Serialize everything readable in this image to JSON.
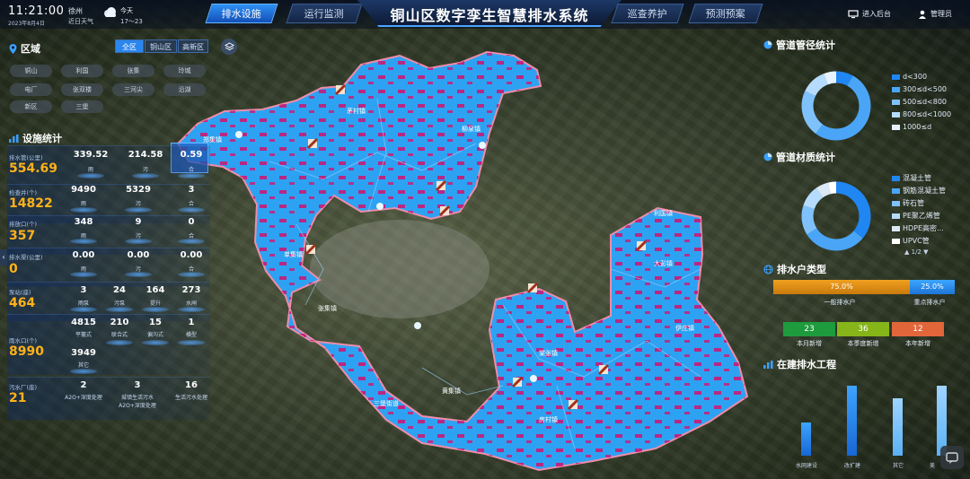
{
  "header": {
    "time": "11:21:00",
    "date": "2023年8月4日",
    "city": "徐州",
    "weather_label": "近日天气",
    "today_label": "今天",
    "temperature": "17～23",
    "title": "铜山区数字孪生智慧排水系统",
    "tabs": [
      "排水设施",
      "运行监测",
      "巡查养护",
      "预测预案"
    ],
    "active_tab": "排水设施",
    "backend": "进入后台",
    "user": "管理员"
  },
  "region": {
    "title": "区域",
    "segments": [
      "全区",
      "铜山区",
      "高新区"
    ],
    "active_segment": "全区",
    "districts": [
      "铜山",
      "利国",
      "张集",
      "玲城",
      "电厂",
      "张双楼",
      "三河尖",
      "沿湖",
      "新区",
      "三堡"
    ]
  },
  "facility": {
    "title": "设施统计",
    "rows": [
      {
        "label": "排水管(公里)",
        "total": "554.69",
        "cells": [
          {
            "value": "339.52",
            "sub": "雨"
          },
          {
            "value": "214.58",
            "sub": "污"
          },
          {
            "value": "0.59",
            "sub": "合"
          }
        ]
      },
      {
        "label": "检查井(个)",
        "total": "14822",
        "cells": [
          {
            "value": "9490",
            "sub": "雨"
          },
          {
            "value": "5329",
            "sub": "污"
          },
          {
            "value": "3",
            "sub": "合"
          }
        ]
      },
      {
        "label": "排放口(个)",
        "total": "357",
        "cells": [
          {
            "value": "348",
            "sub": "雨"
          },
          {
            "value": "9",
            "sub": "污"
          },
          {
            "value": "0",
            "sub": "合"
          }
        ]
      },
      {
        "label": "排水渠(公里)",
        "total": "0",
        "cells": [
          {
            "value": "0.00",
            "sub": "雨"
          },
          {
            "value": "0.00",
            "sub": "污"
          },
          {
            "value": "0.00",
            "sub": "合"
          }
        ]
      },
      {
        "label": "泵站(座)",
        "total": "464",
        "cells": [
          {
            "value": "3",
            "sub": "雨泵"
          },
          {
            "value": "24",
            "sub": "污泵"
          },
          {
            "value": "164",
            "sub": "提升"
          },
          {
            "value": "273",
            "sub": "水闸"
          }
        ]
      },
      {
        "label": "雨水口(个)",
        "total": "8990",
        "cells": [
          {
            "value": "4815",
            "sub": "平篦式"
          },
          {
            "value": "210",
            "sub": "联合式"
          },
          {
            "value": "15",
            "sub": "偏沟式"
          },
          {
            "value": "1",
            "sub": "横型"
          },
          {
            "value": "3949",
            "sub": "其它"
          }
        ]
      },
      {
        "label": "污水厂(座)",
        "total": "21",
        "cells": [
          {
            "value": "2",
            "sub": "A2O+深度处理"
          },
          {
            "value": "3",
            "sub": "城镇生活污水A2O+深度处理"
          },
          {
            "value": "16",
            "sub": "生活污水处理"
          }
        ]
      }
    ]
  },
  "pipe_diameter": {
    "title": "管道管径统计",
    "legend": [
      "d<300",
      "300≤d<500",
      "500≤d<800",
      "800≤d<1000",
      "1000≤d"
    ],
    "colors": [
      "#1f86f2",
      "#4aa5f7",
      "#7fc2fb",
      "#b6dcfd",
      "#e6f3ff"
    ],
    "shares": [
      0.08,
      0.52,
      0.22,
      0.12,
      0.06
    ]
  },
  "pipe_material": {
    "title": "管道材质统计",
    "legend": [
      "混凝土管",
      "钢筋混凝土管",
      "砖石管",
      "PE聚乙烯管",
      "HDPE高密...",
      "UPVC管"
    ],
    "colors": [
      "#1f86f2",
      "#4aa5f7",
      "#7fc2fb",
      "#b6dcfd",
      "#dbe9f6",
      "#ffffff"
    ],
    "shares": [
      0.36,
      0.3,
      0.14,
      0.1,
      0.06,
      0.04
    ],
    "pager": "1/2"
  },
  "household": {
    "title": "排水户类型",
    "general_pct": "75.0%",
    "key_pct": "25.0%",
    "general_label": "一般排水户",
    "key_label": "重点排水户",
    "counts": [
      {
        "value": "23",
        "label": "本月新增",
        "color": "#1e9b3c"
      },
      {
        "value": "36",
        "label": "本季度新增",
        "color": "#86b51a"
      },
      {
        "value": "12",
        "label": "本年新增",
        "color": "#e2663a"
      }
    ]
  },
  "projects": {
    "title": "在建排水工程",
    "categories": [
      "水网建设",
      "改扩建",
      "其它",
      "美"
    ],
    "values": [
      0.45,
      0.95,
      0.78,
      0.95
    ]
  },
  "map_labels": [
    "房村镇",
    "棠张镇",
    "茅村镇",
    "柳泉镇",
    "利国镇",
    "大彭镇",
    "郑集镇",
    "单集镇",
    "伊庄镇",
    "三堡街道",
    "黄集镇",
    "张集镇"
  ]
}
